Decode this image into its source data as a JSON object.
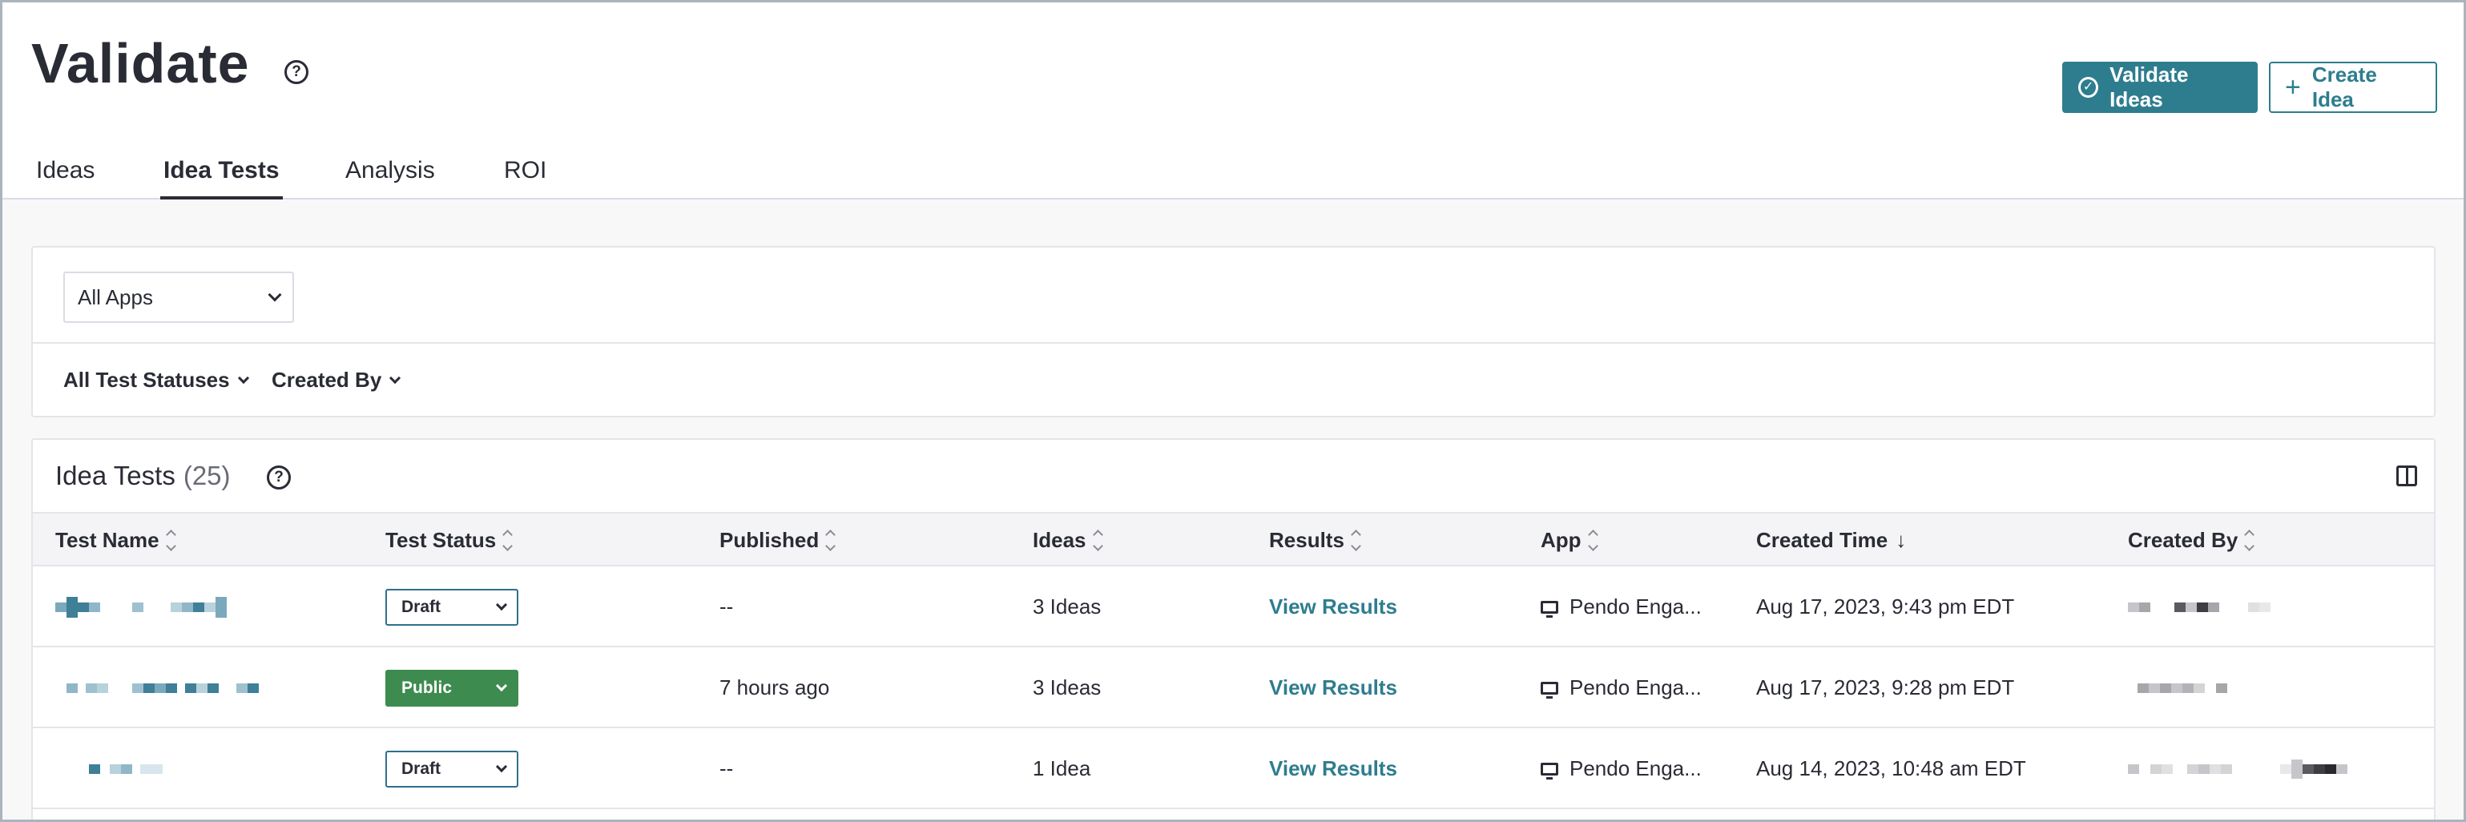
{
  "header": {
    "title": "Validate",
    "validate_button": "Validate Ideas",
    "create_button": "Create Idea"
  },
  "tabs": [
    {
      "label": "Ideas",
      "active": false
    },
    {
      "label": "Idea Tests",
      "active": true
    },
    {
      "label": "Analysis",
      "active": false
    },
    {
      "label": "ROI",
      "active": false
    }
  ],
  "filters": {
    "app_select": "All Apps",
    "status_filter": "All Test Statuses",
    "created_by_filter": "Created By"
  },
  "table": {
    "title": "Idea Tests",
    "count": "(25)",
    "columns": {
      "test_name": "Test Name",
      "test_status": "Test Status",
      "published": "Published",
      "ideas": "Ideas",
      "results": "Results",
      "app": "App",
      "created_time": "Created Time",
      "created_by": "Created By"
    },
    "rows": [
      {
        "status": "Draft",
        "published": "--",
        "ideas": "3 Ideas",
        "results": "View Results",
        "app": "Pendo Enga...",
        "created_time": "Aug 17, 2023, 9:43 pm EDT"
      },
      {
        "status": "Public",
        "published": "7 hours ago",
        "ideas": "3 Ideas",
        "results": "View Results",
        "app": "Pendo Enga...",
        "created_time": "Aug 17, 2023, 9:28 pm EDT"
      },
      {
        "status": "Draft",
        "published": "--",
        "ideas": "1 Idea",
        "results": "View Results",
        "app": "Pendo Enga...",
        "created_time": "Aug 14, 2023, 10:48 am EDT"
      }
    ]
  },
  "colors": {
    "accent": "#2e7d8e",
    "public_status": "#3d8b4f",
    "text": "#2a2c35"
  }
}
